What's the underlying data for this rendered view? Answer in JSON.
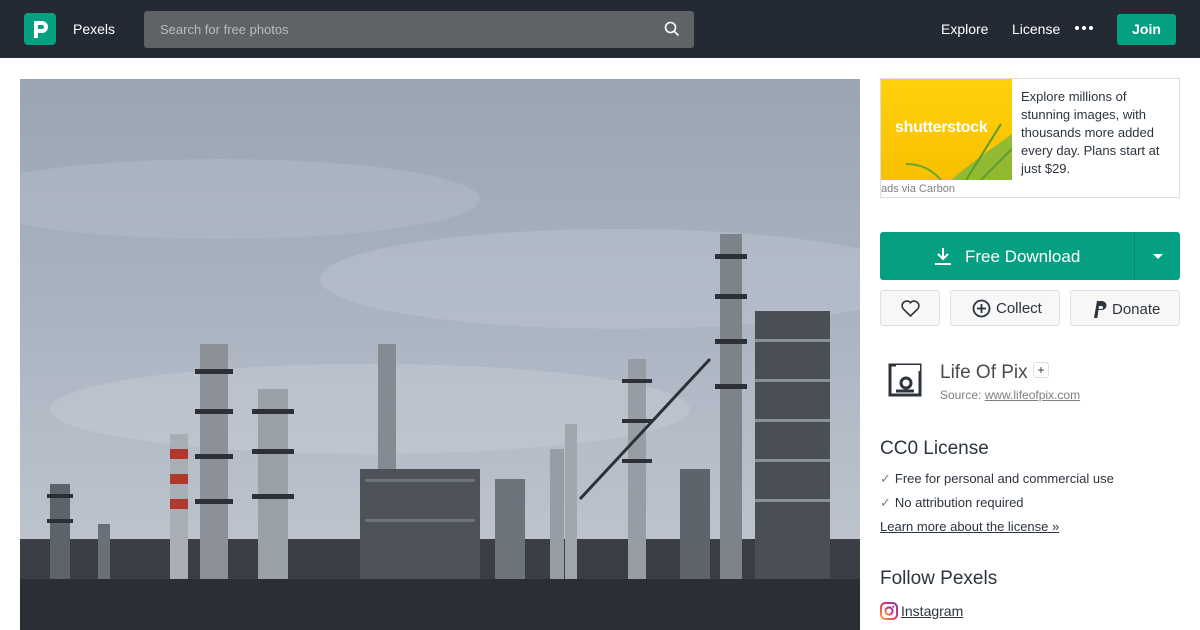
{
  "header": {
    "brand": "Pexels",
    "search_placeholder": "Search for free photos",
    "nav": {
      "explore": "Explore",
      "license": "License"
    },
    "join_label": "Join"
  },
  "photo": {
    "alt": "Industrial refinery towers against a cloudy sky"
  },
  "ad": {
    "brand": "shutterstock",
    "text": "Explore millions of stunning images, with thousands more added every day. Plans start at just $29.",
    "via": "ads via Carbon"
  },
  "actions": {
    "download_label": "Free Download",
    "collect_label": "Collect",
    "donate_label": "Donate"
  },
  "author": {
    "name": "Life Of Pix",
    "follow_symbol": "+",
    "source_prefix": "Source:",
    "source_link": "www.lifeofpix.com"
  },
  "license": {
    "title": "CC0 License",
    "check": "✓",
    "items": [
      "Free for personal and commercial use",
      "No attribution required"
    ],
    "learn_more": "Learn more about the license »"
  },
  "follow": {
    "title": "Follow Pexels",
    "instagram": "Instagram"
  },
  "colors": {
    "header_bg": "#232a34",
    "accent": "#05a081",
    "search_bg": "#5f6367"
  }
}
